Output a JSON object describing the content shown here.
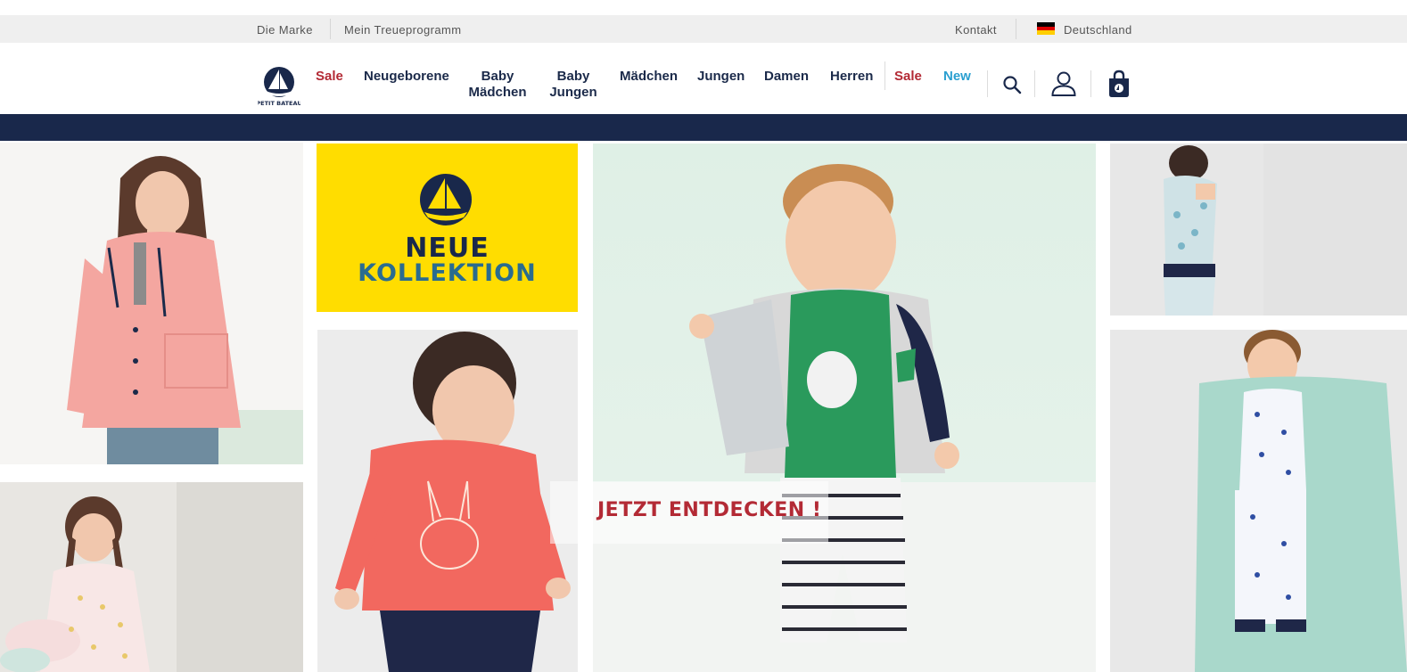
{
  "topbar": {
    "brand": "Die Marke",
    "loyalty": "Mein Treueprogramm",
    "contact": "Kontakt",
    "country": "Deutschland"
  },
  "nav": {
    "sale_1": "Sale",
    "newborn": "Neugeborene",
    "baby_girls_1": "Baby",
    "baby_girls_2": "Mädchen",
    "baby_boys_1": "Baby",
    "baby_boys_2": "Jungen",
    "girls": "Mädchen",
    "boys": "Jungen",
    "women": "Damen",
    "men": "Herren",
    "sale_2": "Sale",
    "new": "New"
  },
  "logo": {
    "text": "PETIT BATEAU"
  },
  "promo": {
    "neue": "NEUE",
    "kollektion": "KOLLEKTION",
    "cta": "JETZT ENTDECKEN !"
  },
  "colors": {
    "navy": "#19284b",
    "sale_red": "#b32a35",
    "new_blue": "#2a9fd0",
    "promo_yellow": "#ffdd00"
  },
  "icons": [
    "search-icon",
    "user-icon",
    "shopping-bag-icon",
    "german-flag-icon",
    "sailboat-logo-icon"
  ]
}
